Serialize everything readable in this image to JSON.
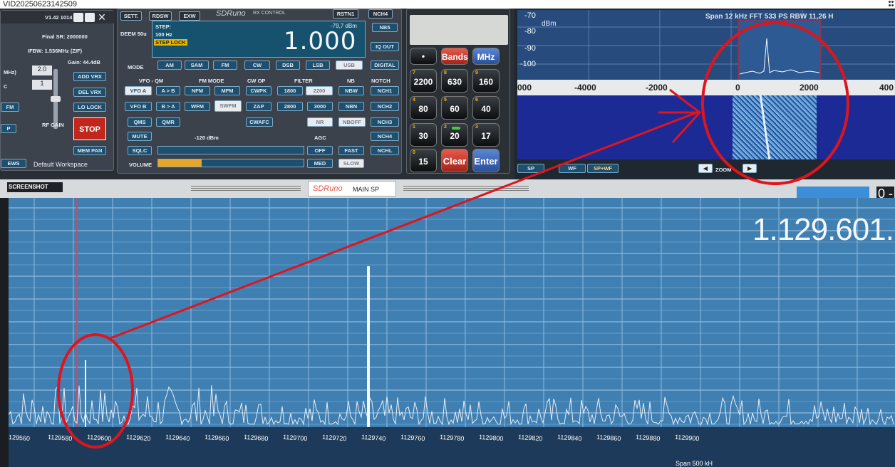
{
  "window": {
    "title": "VID20250623142509"
  },
  "left_panel": {
    "version": "V1.42 1014",
    "final_sr": "Final SR: 2000000",
    "ifbw": "IFBW: 1.536MHz (ZIF)",
    "gain": "Gain: 44.4dB",
    "mhz_label": "MHz)",
    "val1": "2.0",
    "val2": "1",
    "c_label": "C",
    "add_vrx": "ADD VRX",
    "del_vrx": "DEL VRX",
    "lo_lock": "LO LOCK",
    "stop": "STOP",
    "rf_gain": "RF GAIN",
    "mem_pan": "MEM PAN",
    "fm_frag": "FM",
    "p_frag": "P",
    "ews": "EWS",
    "workspace": "Default Workspace"
  },
  "rx_control": {
    "tabs": [
      "SETT.",
      "RDSW",
      "EXW"
    ],
    "brand": "SDRuno",
    "title": "RX CONTROL",
    "right_tabs": [
      "RSTN1",
      "NCH4"
    ],
    "dbm_top": "-79,7 dBm",
    "freq": "1.000",
    "step_label": "STEP:",
    "step_value": "100 Hz",
    "step_lock": "STEP LOCK",
    "nb_top": "NB5",
    "dbm_mid": "-120 dBm",
    "deem": "DEEM 50u",
    "mode_label": "MODE",
    "modes": [
      "AM",
      "SAM",
      "FM",
      "CW",
      "DSB",
      "LSB",
      "USB",
      "DIGITAL"
    ],
    "iq_out": "IQ OUT",
    "vfo_qm": "VFO - QM",
    "fm_mode": "FM MODE",
    "cw_op": "CW OP",
    "filter": "FILTER",
    "nb": "NB",
    "notch": "NOTCH",
    "row1": [
      "VFO A",
      "A > B",
      "NFM",
      "MFM",
      "CWPK",
      "1800",
      "2200",
      "NBW",
      "NCH1"
    ],
    "row2": [
      "VFO B",
      "B > A",
      "WFM",
      "SWFM",
      "ZAP",
      "2800",
      "3000",
      "NBN",
      "NCH2"
    ],
    "row3": [
      "QMS",
      "QMR",
      "CWAFC",
      "NR",
      "NBOFF",
      "NCH3"
    ],
    "mute": "MUTE",
    "agc": "AGC",
    "nch4": "NCH4",
    "sqlc": "SQLC",
    "agc_btns": [
      "OFF",
      "FAST",
      "MED",
      "SLOW"
    ],
    "nchl": "NCHL",
    "volume": "VOLUME",
    "volume_level": 0.3
  },
  "keypad": {
    "bands": "Bands",
    "mhz": "MHz",
    "keys": [
      {
        "sub": "7",
        "n": "2200"
      },
      {
        "sub": "8",
        "n": "630"
      },
      {
        "sub": "9",
        "n": "160"
      },
      {
        "sub": "4",
        "n": "80"
      },
      {
        "sub": "5",
        "n": "60"
      },
      {
        "sub": "6",
        "n": "40"
      },
      {
        "sub": "1",
        "n": "30"
      },
      {
        "sub": "2",
        "n": "20"
      },
      {
        "sub": "3",
        "n": "17"
      },
      {
        "sub": "0",
        "n": "15"
      }
    ],
    "clear": "Clear",
    "enter": "Enter"
  },
  "aux_spectrum": {
    "span_info": "Span 12 kHz   FFT 533 PS   RBW 11,26 H",
    "dbm_label": "dBm",
    "y_ticks": [
      "-70",
      "-80",
      "-90",
      "-100"
    ],
    "x_ticks": [
      "000",
      "-4000",
      "-2000",
      "0",
      "2000",
      "400"
    ],
    "buttons": [
      "SP",
      "WF",
      "SP+WF"
    ],
    "zoom": "ZOOM"
  },
  "main_sp": {
    "screenshot_tab": "SCREENSHOT",
    "brand": "SDRuno",
    "title": "MAIN SP",
    "freq_readout": "1.129.601.",
    "corner": "0 -",
    "x_ticks": [
      "129560",
      "1129580",
      "1129600",
      "1129620",
      "1129640",
      "1129660",
      "1129680",
      "1129700",
      "1129720",
      "1129740",
      "1129760",
      "1129780",
      "1129800",
      "1129820",
      "1129840",
      "1129860",
      "1129880",
      "1129900"
    ],
    "span_frag": "Span 500 kH"
  },
  "colors": {
    "accent_blue": "#1f4f6e",
    "spectrum_bg": "#3f7fb1",
    "annotation": "#e0141c"
  }
}
